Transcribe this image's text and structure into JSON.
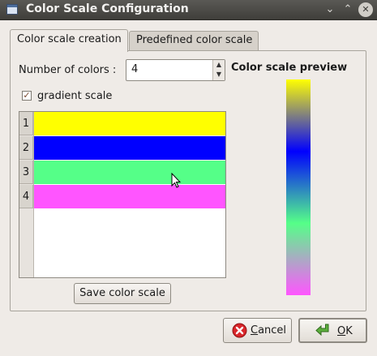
{
  "window": {
    "title": "Color Scale Configuration"
  },
  "tabs": [
    {
      "label": "Color scale creation",
      "active": true
    },
    {
      "label": "Predefined color scale",
      "active": false
    }
  ],
  "form": {
    "num_colors_label": "Number of colors :",
    "num_colors_value": "4",
    "gradient_label": "gradient scale",
    "gradient_checked": true
  },
  "color_rows": [
    {
      "index": "1",
      "color": "#ffff00"
    },
    {
      "index": "2",
      "color": "#0000ff"
    },
    {
      "index": "3",
      "color": "#55ff88"
    },
    {
      "index": "4",
      "color": "#ff55ff"
    }
  ],
  "save_button_label": "Save color scale",
  "preview": {
    "title": "Color scale preview"
  },
  "buttons": {
    "cancel_label": "Cancel",
    "cancel_mnemonic": "C",
    "cancel_rest": "ancel",
    "ok_label": "OK",
    "ok_mnemonic": "O",
    "ok_rest": "K"
  },
  "icons": {
    "cancel": "cancel-icon",
    "ok": "ok-arrow-icon",
    "mouse": "mouse-cursor-icon"
  }
}
